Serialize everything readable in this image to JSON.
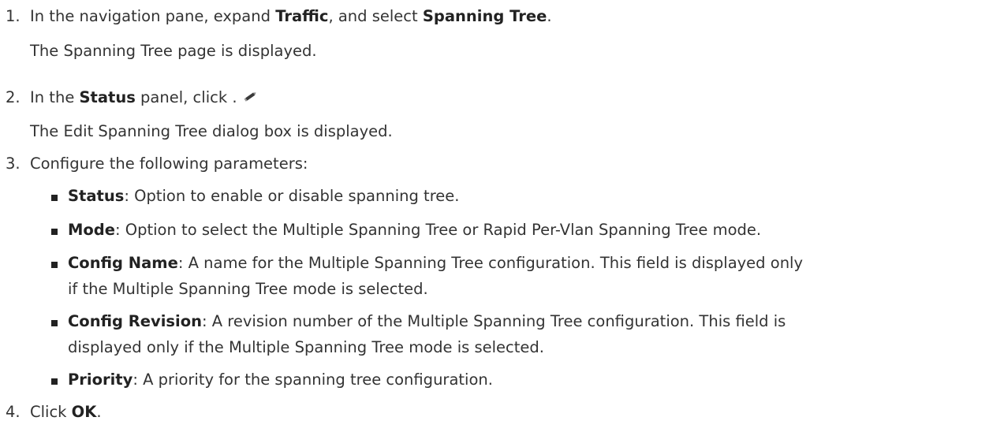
{
  "steps": [
    {
      "number": "1.",
      "pre": "In the navigation pane, expand ",
      "bold1": "Traffic",
      "mid": ", and select ",
      "bold2": "Spanning Tree",
      "post": ".",
      "result": "The Spanning Tree page is displayed."
    },
    {
      "number": "2.",
      "pre": "In the ",
      "bold1": "Status",
      "post": " panel, click .",
      "icon": "edit-pencil-icon",
      "result": "The Edit Spanning Tree dialog box is displayed."
    },
    {
      "number": "3.",
      "text": "Configure the following parameters:",
      "params": [
        {
          "name": "Status",
          "lines": [
            ": Option to enable or disable spanning tree."
          ]
        },
        {
          "name": "Mode",
          "lines": [
            ": Option to select the Multiple Spanning Tree or Rapid Per-Vlan Spanning Tree mode."
          ]
        },
        {
          "name": "Config Name",
          "lines": [
            ": A name for the Multiple Spanning Tree configuration. This field is displayed only",
            "if the Multiple Spanning Tree mode is selected."
          ]
        },
        {
          "name": "Config Revision",
          "lines": [
            ": A revision number of the Multiple Spanning Tree configuration. This field is",
            "displayed only if the Multiple Spanning Tree mode is selected."
          ]
        },
        {
          "name": "Priority",
          "lines": [
            ": A priority for the spanning tree configuration."
          ]
        }
      ]
    },
    {
      "number": "4.",
      "pre": "Click ",
      "bold1": "OK",
      "post": "."
    }
  ]
}
